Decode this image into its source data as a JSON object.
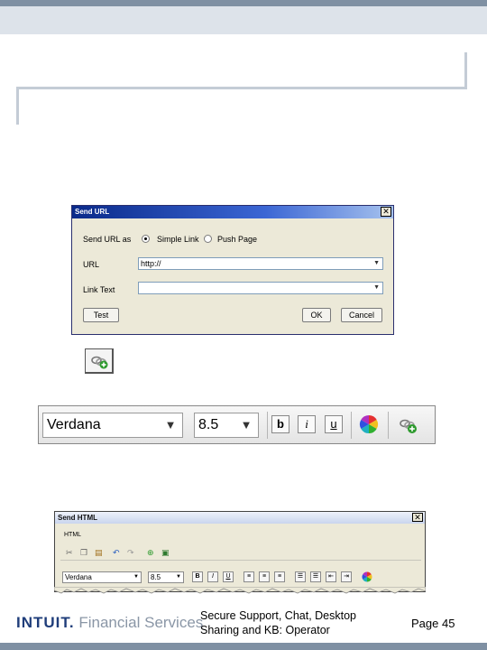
{
  "send_url_dialog": {
    "title": "Send URL",
    "close_glyph": "✕",
    "send_as_label": "Send URL as",
    "option_simple": "Simple Link",
    "option_push": "Push Page",
    "selected_option": "Simple Link",
    "url_label": "URL",
    "url_value": "http://",
    "link_text_label": "Link Text",
    "link_text_value": "",
    "test_button": "Test",
    "ok_button": "OK",
    "cancel_button": "Cancel"
  },
  "toolbar": {
    "font": "Verdana",
    "size": "8.5",
    "bold": "b",
    "italic": "i",
    "underline": "u",
    "icons": [
      "color-wheel-icon",
      "add-link-icon"
    ]
  },
  "send_html_window": {
    "title": "Send HTML",
    "close_glyph": "✕",
    "mode_label": "HTML",
    "font": "Verdana",
    "size": "8.5",
    "bold": "B",
    "italic": "I",
    "underline": "U"
  },
  "footer": {
    "brand_name": "INTUIT.",
    "brand_sub": "Financial Services",
    "title_line1": "Secure Support, Chat, Desktop",
    "title_line2": "Sharing and KB: Operator",
    "page": "Page 45"
  },
  "colors": {
    "title_bar": "#0a2a8a",
    "dialog_bg": "#ece9d8",
    "band": "#7f90a3",
    "brand": "#1f3d7a"
  }
}
